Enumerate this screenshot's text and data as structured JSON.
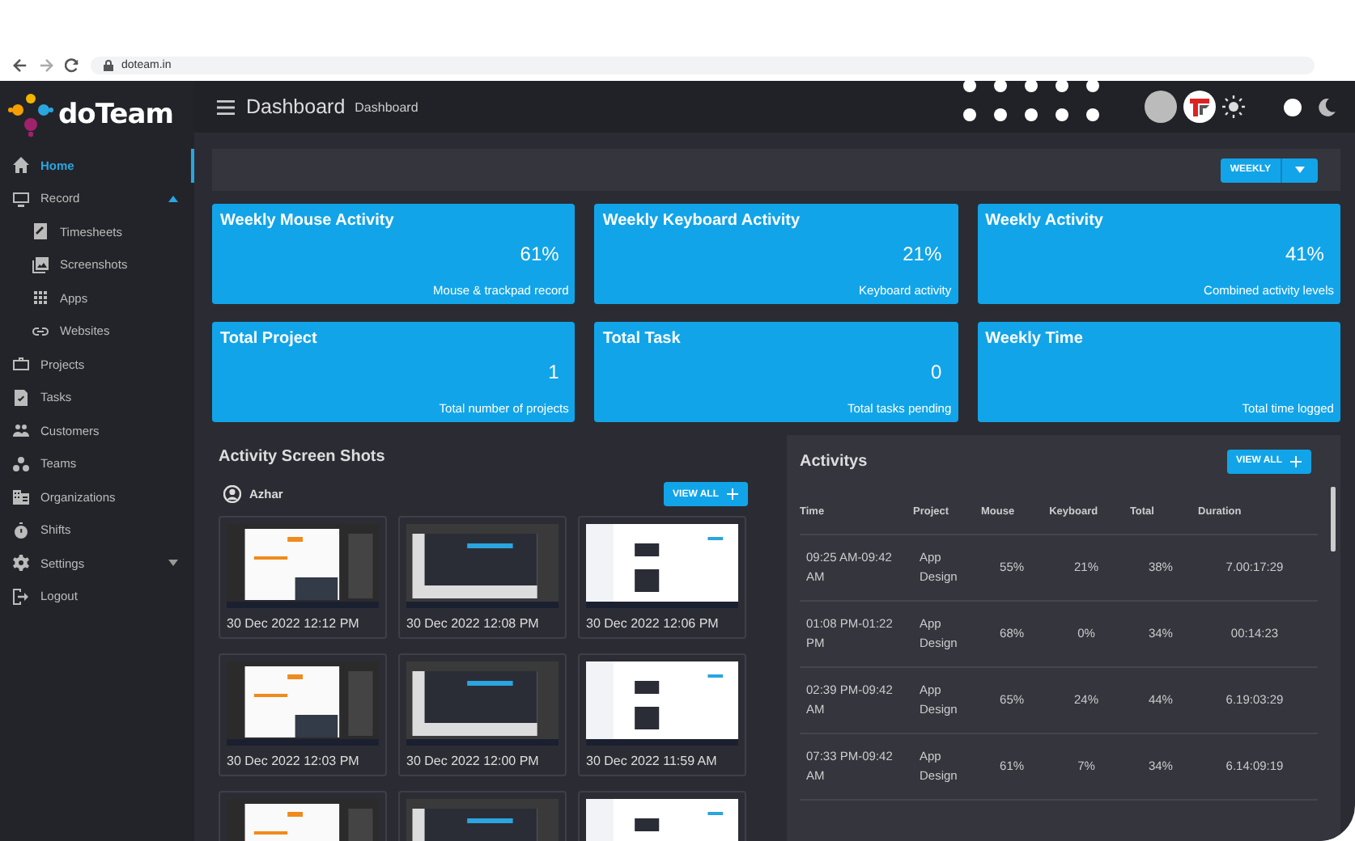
{
  "browser": {
    "url": "doteam.in"
  },
  "app": {
    "logo": "doTeam",
    "header_title": "Dashboard",
    "breadcrumb": "Dashboard"
  },
  "sidebar": {
    "items": [
      {
        "label": "Home",
        "selected": true
      },
      {
        "label": "Record",
        "selected": false,
        "expanded": true,
        "children": [
          {
            "label": "Timesheets",
            "selected": false
          },
          {
            "label": "Screenshots",
            "selected": false
          },
          {
            "label": "Apps",
            "selected": false
          },
          {
            "label": "Websites",
            "selected": false
          }
        ]
      },
      {
        "label": "Projects",
        "selected": false
      },
      {
        "label": "Tasks",
        "selected": false
      },
      {
        "label": "Customers",
        "selected": false
      },
      {
        "label": "Teams",
        "selected": false
      },
      {
        "label": "Organizations",
        "selected": false
      },
      {
        "label": "Shifts",
        "selected": false
      },
      {
        "label": "Settings",
        "selected": false,
        "expanded": false
      },
      {
        "label": "Logout",
        "selected": false
      }
    ]
  },
  "period_button": "WEEKLY",
  "stats": [
    {
      "title": "Weekly Mouse Activity",
      "value": "61%",
      "caption": "Mouse & trackpad record"
    },
    {
      "title": "Weekly Keyboard Activity",
      "value": "21%",
      "caption": "Keyboard activity"
    },
    {
      "title": "Weekly Activity",
      "value": "41%",
      "caption": "Combined activity levels"
    },
    {
      "title": "Total Project",
      "value": "1",
      "caption": "Total number of projects"
    },
    {
      "title": "Total Task",
      "value": "0",
      "caption": "Total tasks pending"
    },
    {
      "title": "Weekly Time",
      "caption": "Total time logged"
    }
  ],
  "screenshots": {
    "title": "Activity Screen Shots",
    "user": "Azhar",
    "button": "VIEW ALL",
    "items": [
      {
        "kind": "shot",
        "caption": "30 Dec 2022 12:12 PM"
      },
      {
        "kind": "shot",
        "caption": "30 Dec 2022 12:08 PM"
      },
      {
        "kind": "shot",
        "caption": "30 Dec 2022 12:06 PM"
      },
      {
        "kind": "shot",
        "caption": "30 Dec 2022 12:03 PM"
      },
      {
        "kind": "shot",
        "caption": "30 Dec 2022 12:00 PM"
      },
      {
        "kind": "shot",
        "caption": "30 Dec 2022 11:59 AM"
      },
      {
        "kind": "picture"
      },
      {
        "kind": "picture"
      },
      {
        "kind": "picture"
      }
    ]
  },
  "activities": {
    "title": "Activitys",
    "button": "VIEW ALL",
    "columns": [
      "Time",
      "Project",
      "Mouse",
      "Keyboard",
      "Total",
      "Duration"
    ],
    "rows": [
      [
        "09:25 AM-09:42 AM",
        "App Design",
        "55%",
        "21%",
        "38%",
        "7.00:17:29"
      ],
      [
        "01:08 PM-01:22 PM",
        "App Design",
        "68%",
        "0%",
        "34%",
        "00:14:23"
      ],
      [
        "02:39 PM-09:42 AM",
        "App Design",
        "65%",
        "24%",
        "44%",
        "6.19:03:29"
      ],
      [
        "07:33 PM-09:42 AM",
        "App Design",
        "61%",
        "7%",
        "34%",
        "6.14:09:19"
      ]
    ]
  }
}
